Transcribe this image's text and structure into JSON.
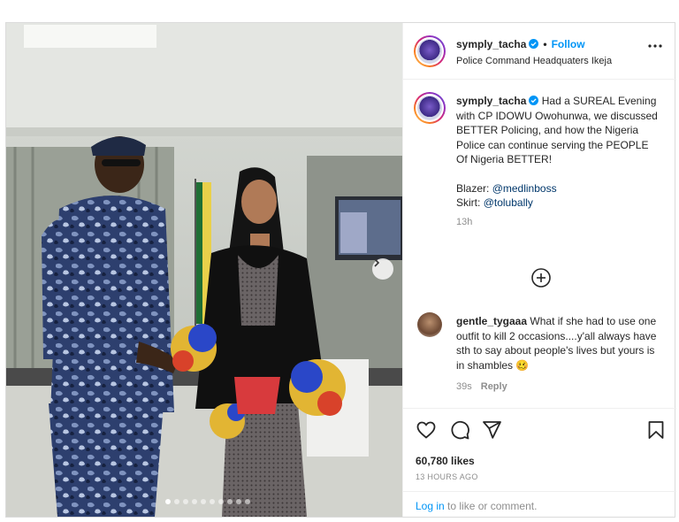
{
  "post": {
    "username": "symply_tacha",
    "follow_label": "Follow",
    "separator": "•",
    "location": "Police Command Headquaters Ikeja"
  },
  "caption": {
    "username": "symply_tacha",
    "text": "Had a SUREAL Evening with CP IDOWU Owohunwa, we discussed BETTER Policing, and how the Nigeria Police can continue serving the PEOPLE Of Nigeria BETTER!",
    "blazer_label": "Blazer:",
    "blazer_handle": "@medlinboss",
    "skirt_label": "Skirt:",
    "skirt_handle": "@tolubally",
    "time": "13h"
  },
  "comment": {
    "username": "gentle_tygaaa",
    "text": "What if she had to use one outfit to kill 2 occasions....y'all always have sth to say about people's lives but yours is in shambles 🥴",
    "time": "39s",
    "reply_label": "Reply"
  },
  "stats": {
    "likes": "60,780 likes",
    "posted": "13 HOURS AGO"
  },
  "footer": {
    "login_link": "Log in",
    "login_text": " to like or comment."
  },
  "carousel": {
    "count": 10,
    "active_index": 0
  },
  "colors": {
    "accent": "#0095f6",
    "mention": "#00376b",
    "muted": "#8e8e8e"
  }
}
